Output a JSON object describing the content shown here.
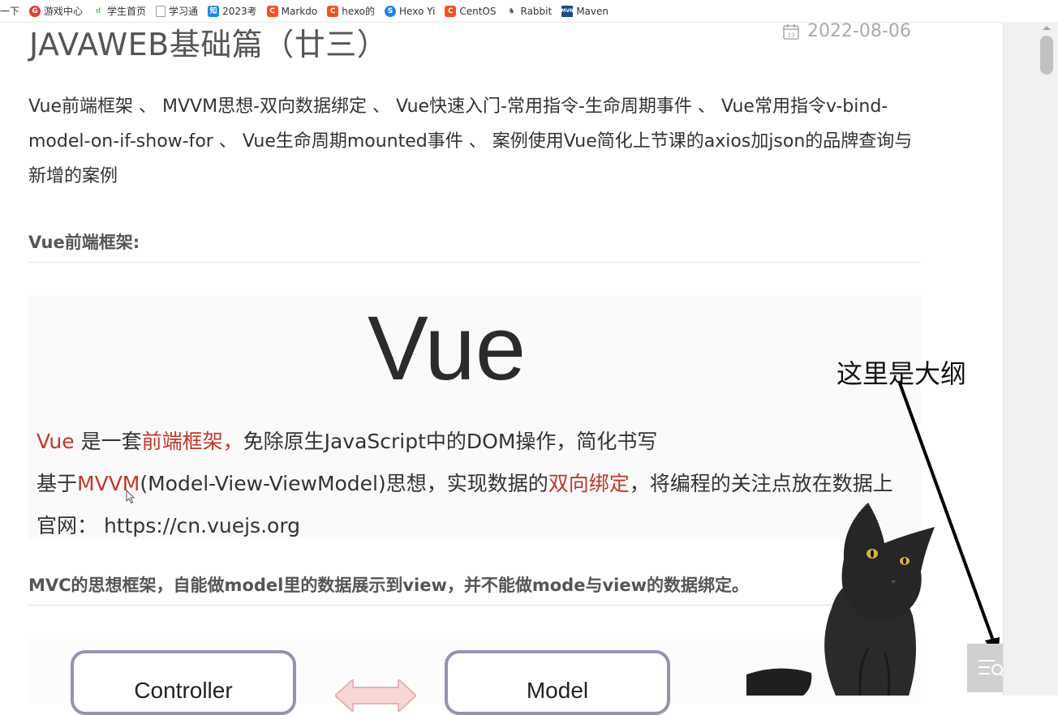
{
  "bookmarks": {
    "first": "一下",
    "items": [
      {
        "label": "游戏中心",
        "icon": "game-center-icon",
        "color": "#e53935",
        "glyph": "G"
      },
      {
        "label": "学生首页",
        "icon": "signal-bars-icon",
        "color": "#66bb6a",
        "glyph": "ıl"
      },
      {
        "label": "学习通",
        "icon": "page-icon",
        "color": "#9e9e9e",
        "glyph": ""
      },
      {
        "label": "2023考",
        "icon": "zhihu-icon",
        "color": "#1e88e5",
        "glyph": "知"
      },
      {
        "label": "Markdo",
        "icon": "csdn-icon",
        "color": "#f4511e",
        "glyph": "C"
      },
      {
        "label": "hexo的",
        "icon": "csdn-icon",
        "color": "#f4511e",
        "glyph": "C"
      },
      {
        "label": "Hexo Yi",
        "icon": "s-icon",
        "color": "#1e88e5",
        "glyph": "S"
      },
      {
        "label": "CentOS",
        "icon": "csdn-icon",
        "color": "#f4511e",
        "glyph": "C"
      },
      {
        "label": "Rabbit",
        "icon": "rabbit-icon",
        "color": "#555555",
        "glyph": "♞"
      },
      {
        "label": "Maven",
        "icon": "mvn-icon",
        "color": "#1a4b8c",
        "glyph": "MVN"
      }
    ]
  },
  "post": {
    "title": "JAVAWEB基础篇（廿三）",
    "date": "2022-08-06",
    "summary": "Vue前端框架 、 MVVM思想-双向数据绑定 、 Vue快速入门-常用指令-生命周期事件 、 Vue常用指令v-bind-model-on-if-show-for 、 Vue生命周期mounted事件 、 案例使用Vue简化上节课的axios加json的品牌查询与新增的案例",
    "heading1": "Vue前端框架:",
    "heading2": "MVC的思想框架，自能做model里的数据展示到view，并不能做mode与view的数据绑定。"
  },
  "slide": {
    "logo": "Vue",
    "line1": {
      "a": "Vue",
      "b": " 是一套",
      "c": "前端框架，",
      "d": "免除原生JavaScript中的DOM操作，简化书写"
    },
    "line2": {
      "a": "基于",
      "b": "MVVM",
      "c": "(Model-View-ViewModel)思想，实现数据的",
      "d": "双向绑定",
      "e": "，将编程的关注点放在数据上"
    },
    "line3": "官网： https://cn.vuejs.org"
  },
  "diagram": {
    "box1": "Controller",
    "box2": "Model"
  },
  "annotation": "这里是大纲",
  "colors": {
    "accent_red": "#c0392b",
    "title": "#555555",
    "date": "#aaaaaa"
  }
}
